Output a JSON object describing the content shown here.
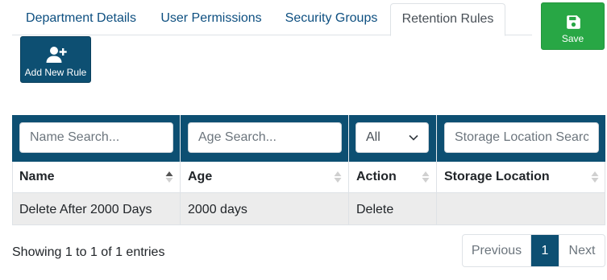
{
  "tabs": [
    {
      "label": "Department Details",
      "active": false
    },
    {
      "label": "User Permissions",
      "active": false
    },
    {
      "label": "Security Groups",
      "active": false
    },
    {
      "label": "Retention Rules",
      "active": true
    }
  ],
  "toolbar": {
    "save_label": "Save",
    "save_icon": "floppy-disk-icon",
    "add_label": "Add New Rule",
    "add_icon": "user-plus-icon"
  },
  "filters": {
    "name_placeholder": "Name Search...",
    "age_placeholder": "Age Search...",
    "action_selected": "All",
    "storage_placeholder": "Storage Location Search..."
  },
  "columns": [
    "Name",
    "Age",
    "Action",
    "Storage Location"
  ],
  "rows": [
    {
      "name": "Delete After 2000 Days",
      "age": "2000 days",
      "action": "Delete",
      "storage": ""
    }
  ],
  "info": "Showing 1 to 1 of 1 entries",
  "pagination": {
    "previous": "Previous",
    "current": "1",
    "next": "Next"
  },
  "colors": {
    "primary": "#0d4f72",
    "save": "#28a745",
    "tab_text": "#0d4f80",
    "row_bg": "#ececec"
  }
}
